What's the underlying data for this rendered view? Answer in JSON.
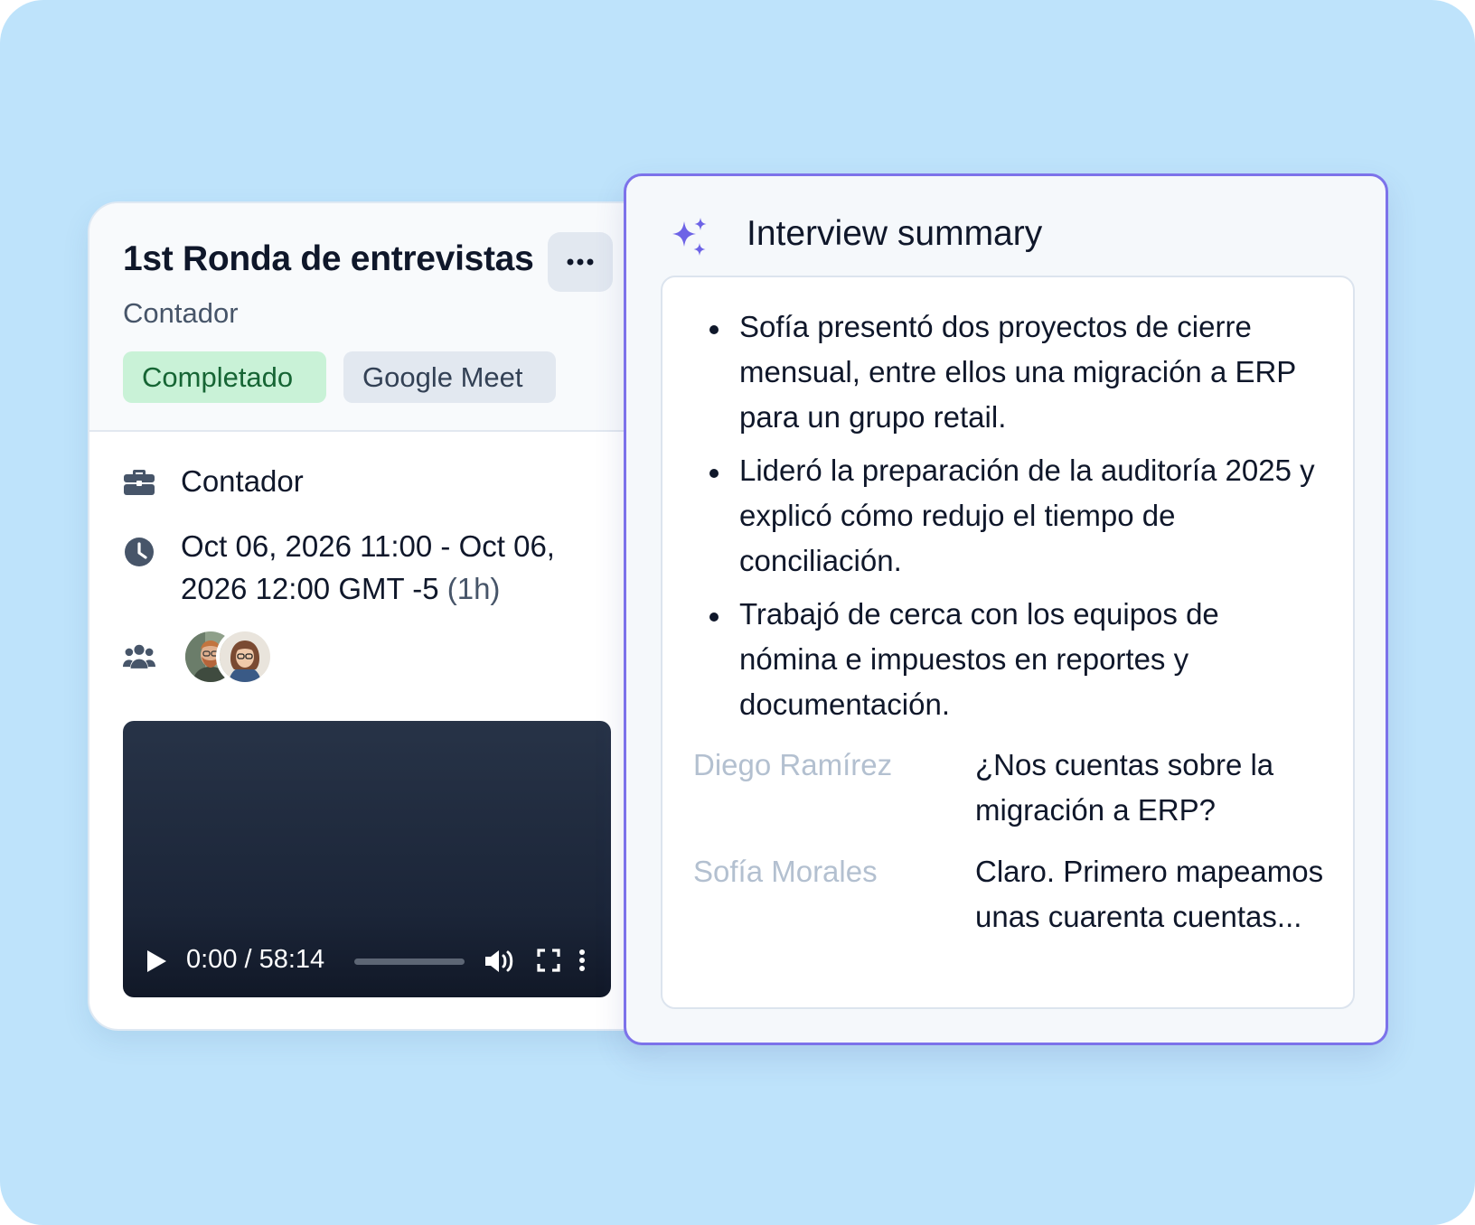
{
  "interview": {
    "title": "1st Ronda de entrevistas",
    "subtitle": "Contador",
    "status": "Completado",
    "platform": "Google Meet",
    "role": "Contador",
    "time_line1": "Oct 06, 2026 11:00 - Oct 06,",
    "time_line2": "2026 12:00 GMT -5",
    "duration": "(1h)",
    "participants": [
      {
        "icon": "avatar-man-beard",
        "color": "#7a8a6a"
      },
      {
        "icon": "avatar-woman-glasses",
        "color": "#b48a6a"
      }
    ]
  },
  "video": {
    "time": "0:00 / 58:14",
    "progress": 0.0
  },
  "summary": {
    "title": "Interview summary",
    "icon": "sparkles-icon",
    "bullets": [
      "Sofía presentó dos proyectos de cierre mensual, entre ellos una migración a ERP para un grupo retail.",
      "Lideró la preparación de la auditoría 2025 y explicó cómo redujo el tiempo de conciliación.",
      "Trabajó de cerca con los equipos de nómina e impuestos en reportes y documentación."
    ],
    "transcript": [
      {
        "speaker": "Diego Ramírez",
        "text": "¿Nos cuentas sobre la migración a ERP?"
      },
      {
        "speaker": "Sofía Morales",
        "text": "Claro. Primero mapeamos unas cuarenta cuentas..."
      }
    ]
  },
  "colors": {
    "background": "#bee3fb",
    "accent": "#7c72ea",
    "status_bg": "#c9f2d7",
    "status_text": "#166534"
  }
}
